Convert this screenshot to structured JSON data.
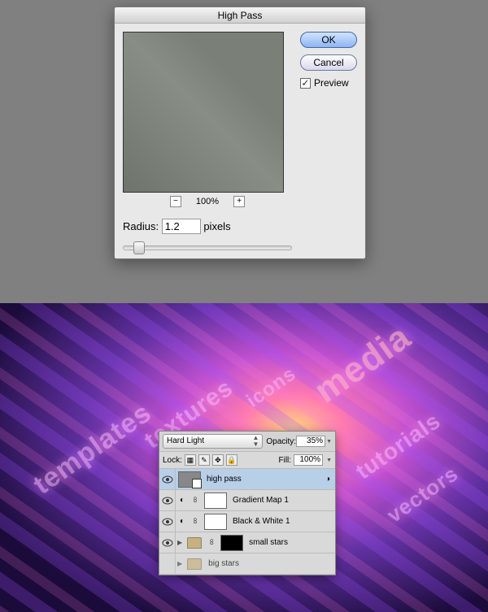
{
  "dialog": {
    "title": "High Pass",
    "zoom": "100%",
    "zoom_out": "−",
    "zoom_in": "+",
    "radius_label": "Radius:",
    "radius_value": "1.2",
    "radius_unit": "pixels",
    "ok": "OK",
    "cancel": "Cancel",
    "preview_chk": "✓",
    "preview_label": "Preview"
  },
  "art_text": {
    "templates": "templates",
    "textures": "textures",
    "icons": "icons",
    "media": "media",
    "tutorials": "tutorials",
    "vectors": "vectors"
  },
  "layers": {
    "blend_mode": "Hard Light",
    "opacity_label": "Opacity:",
    "opacity_value": "35%",
    "lock_label": "Lock:",
    "fill_label": "Fill:",
    "fill_value": "100%",
    "items": [
      {
        "name": "high pass"
      },
      {
        "name": "Gradient Map 1"
      },
      {
        "name": "Black & White 1"
      },
      {
        "name": "small stars"
      },
      {
        "name": "big stars"
      }
    ]
  }
}
